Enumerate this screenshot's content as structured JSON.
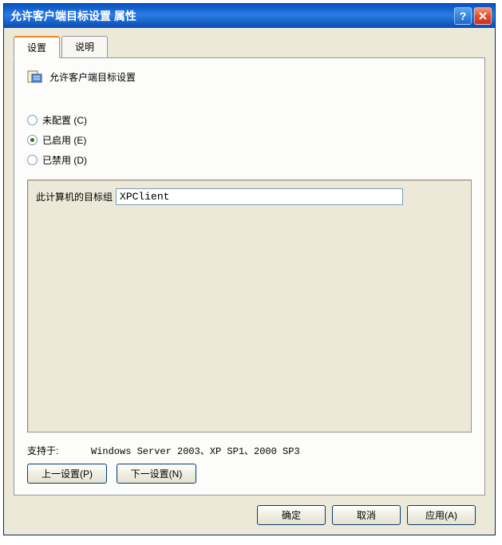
{
  "window": {
    "title": "允许客户端目标设置 属性"
  },
  "tabs": {
    "settings": "设置",
    "explanation": "说明"
  },
  "header": {
    "title": "允许客户端目标设置"
  },
  "radios": {
    "not_configured": "未配置 (C)",
    "enabled": "已启用 (E)",
    "disabled": "已禁用 (D)",
    "selected": "enabled"
  },
  "field": {
    "label": "此计算机的目标组",
    "value": "XPClient"
  },
  "support": {
    "label": "支持于:",
    "text": "Windows Server 2003、XP SP1、2000 SP3"
  },
  "nav": {
    "prev": "上一设置(P)",
    "next": "下一设置(N)"
  },
  "footer": {
    "ok": "确定",
    "cancel": "取消",
    "apply": "应用(A)"
  }
}
